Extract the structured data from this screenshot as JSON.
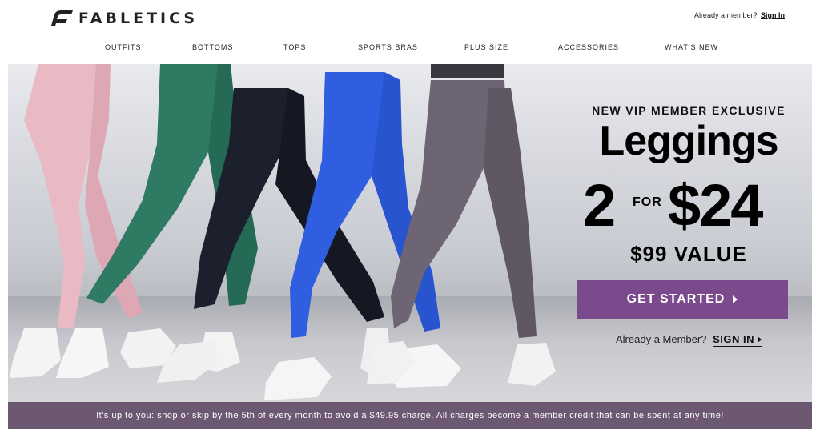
{
  "header": {
    "logo_text": "FABLETICS",
    "member_prompt": "Already a member?",
    "sign_in_link": "Sign In"
  },
  "nav": {
    "items": [
      {
        "label": "OUTFITS"
      },
      {
        "label": "BOTTOMS"
      },
      {
        "label": "TOPS"
      },
      {
        "label": "SPORTS BRAS"
      },
      {
        "label": "PLUS SIZE"
      },
      {
        "label": "ACCESSORIES"
      },
      {
        "label": "WHAT'S NEW"
      }
    ]
  },
  "hero": {
    "kicker": "NEW VIP MEMBER EXCLUSIVE",
    "headline": "Leggings",
    "deal_qty": "2",
    "deal_for": "FOR",
    "deal_price": "$24",
    "value_text": "$99 VALUE",
    "cta_label": "GET STARTED",
    "member_prompt": "Already a Member?",
    "sign_in_label": "SIGN IN",
    "image_alt": "Five models wearing leggings in pink, green, black, blue and grey"
  },
  "footer_banner": {
    "text": "It's up to you: shop or skip by the 5th of every month to avoid a $49.95 charge. All charges become a member credit that can be spent at any time!"
  },
  "colors": {
    "cta": "#7b4a8c",
    "banner": "#6c5870",
    "legging_pink": "#e9b9c4",
    "legging_green": "#2f7a62",
    "legging_black": "#1c1f2c",
    "legging_blue": "#2f5fe0",
    "legging_grey": "#6e6574"
  }
}
